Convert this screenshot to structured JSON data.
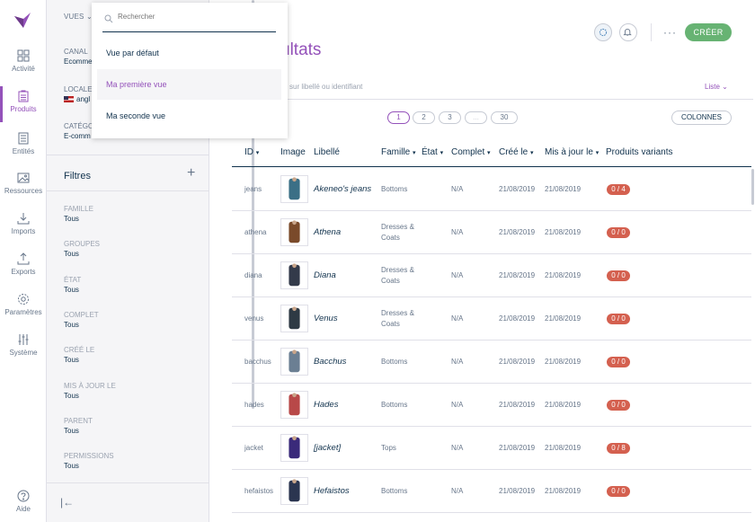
{
  "nav": {
    "items": [
      {
        "label": "Activité",
        "icon": "dashboard-icon"
      },
      {
        "label": "Produits",
        "icon": "products-icon"
      },
      {
        "label": "Entités",
        "icon": "entities-icon"
      },
      {
        "label": "Ressources",
        "icon": "assets-icon"
      },
      {
        "label": "Imports",
        "icon": "import-icon"
      },
      {
        "label": "Exports",
        "icon": "export-icon"
      },
      {
        "label": "Paramètres",
        "icon": "settings-icon"
      },
      {
        "label": "Système",
        "icon": "system-icon"
      }
    ],
    "help": "Aide"
  },
  "filters": {
    "views_label": "VUES",
    "canal_label": "CANAL",
    "canal_value": "Ecomme",
    "locale_label": "LOCALE",
    "locale_value": "angl",
    "category_label": "CATÉGO",
    "category_value": "E-comm",
    "title": "Filtres",
    "items": [
      {
        "label": "FAMILLE",
        "value": "Tous"
      },
      {
        "label": "GROUPES",
        "value": "Tous"
      },
      {
        "label": "ÉTAT",
        "value": "Tous"
      },
      {
        "label": "COMPLET",
        "value": "Tous"
      },
      {
        "label": "CRÉÉ LE",
        "value": "Tous"
      },
      {
        "label": "MIS À JOUR LE",
        "value": "Tous"
      },
      {
        "label": "PARENT",
        "value": "Tous"
      },
      {
        "label": "PERMISSIONS",
        "value": "Tous"
      }
    ]
  },
  "dropdown": {
    "search_placeholder": "Rechercher",
    "items": [
      "Vue par défaut",
      "Ma première vue",
      "Ma seconde vue"
    ],
    "selected_index": 1
  },
  "main": {
    "title": "ultats",
    "search_hint": "sur libellé ou identifiant",
    "display_mode": "Liste",
    "create_button": "CRÉER",
    "columns_button": "COLONNES",
    "pages": [
      "1",
      "2",
      "3",
      "...",
      "30"
    ],
    "current_page": "1"
  },
  "table": {
    "headers": [
      "ID",
      "Image",
      "Libellé",
      "Famille",
      "État",
      "Complet",
      "Créé le",
      "Mis à jour le",
      "Produits variants"
    ],
    "rows": [
      {
        "id": "jeans",
        "label": "Akeneo's jeans",
        "family": "Bottoms",
        "family2": "",
        "complete": "N/A",
        "created": "21/08/2019",
        "updated": "21/08/2019",
        "variants": "0 / 4",
        "thumb_color": "#3b6f86"
      },
      {
        "id": "athena",
        "label": "Athena",
        "family": "Dresses &",
        "family2": "Coats",
        "complete": "N/A",
        "created": "21/08/2019",
        "updated": "21/08/2019",
        "variants": "0 / 0",
        "thumb_color": "#7a4a2a"
      },
      {
        "id": "diana",
        "label": "Diana",
        "family": "Dresses &",
        "family2": "Coats",
        "complete": "N/A",
        "created": "21/08/2019",
        "updated": "21/08/2019",
        "variants": "0 / 0",
        "thumb_color": "#333a4a"
      },
      {
        "id": "venus",
        "label": "Venus",
        "family": "Dresses &",
        "family2": "Coats",
        "complete": "N/A",
        "created": "21/08/2019",
        "updated": "21/08/2019",
        "variants": "0 / 0",
        "thumb_color": "#2e3a44"
      },
      {
        "id": "bacchus",
        "label": "Bacchus",
        "family": "Bottoms",
        "family2": "",
        "complete": "N/A",
        "created": "21/08/2019",
        "updated": "21/08/2019",
        "variants": "0 / 0",
        "thumb_color": "#6b7f93"
      },
      {
        "id": "hades",
        "label": "Hades",
        "family": "Bottoms",
        "family2": "",
        "complete": "N/A",
        "created": "21/08/2019",
        "updated": "21/08/2019",
        "variants": "0 / 0",
        "thumb_color": "#b84848"
      },
      {
        "id": "jacket",
        "label": "[jacket]",
        "family": "Tops",
        "family2": "",
        "complete": "N/A",
        "created": "21/08/2019",
        "updated": "21/08/2019",
        "variants": "0 / 8",
        "thumb_color": "#3a2a7a"
      },
      {
        "id": "hefaistos",
        "label": "Hefaistos",
        "family": "Bottoms",
        "family2": "",
        "complete": "N/A",
        "created": "21/08/2019",
        "updated": "21/08/2019",
        "variants": "0 / 0",
        "thumb_color": "#2b3550"
      }
    ]
  },
  "colors": {
    "accent": "#9452ba",
    "create": "#67b373",
    "badge": "#d4604f",
    "text_dark": "#11324d"
  }
}
